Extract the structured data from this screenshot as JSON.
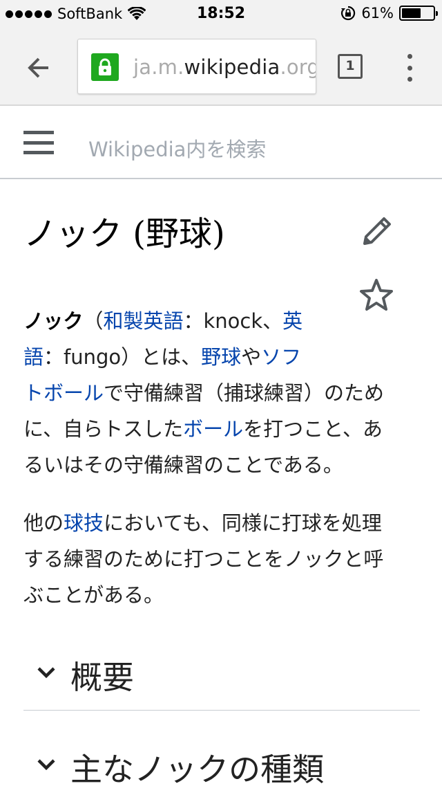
{
  "status_bar": {
    "carrier": "SoftBank",
    "time": "18:52",
    "battery": "61%",
    "battery_level": 0.61
  },
  "browser": {
    "url_domain": "ja.m.wikipedia.org",
    "tab_count": "1"
  },
  "wiki": {
    "search_placeholder": "Wikipedia内を検索",
    "title": "ノック (野球)",
    "para1": {
      "term": "ノック",
      "p_open": "（",
      "link_wasei": "和製英語",
      "t_knock": "：knock、",
      "link_eigo_1": "英",
      "link_eigo_2": "語",
      "t_fungo": "：fungo）とは、",
      "link_yakyu": "野球",
      "t_ya": "や",
      "link_soft_1": "ソフ",
      "link_soft_2": "トボール",
      "t_line3": "で守備練習（捕球練習）のため",
      "t_line4a": "に、自らトスした",
      "link_ball": "ボール",
      "t_line4b": "を打つこと、あ",
      "t_line5": "るいはその守備練習のことである。"
    },
    "para2": {
      "t_line1a": "他の",
      "link_kyugi": "球技",
      "t_line1b": "においても、同様に打球を処理",
      "t_line2": "する練習のために打つことをノックと呼",
      "t_line3": "ぶことがある。"
    },
    "sections": [
      {
        "title": "概要"
      },
      {
        "title": "主なノックの種類"
      }
    ]
  },
  "colors": {
    "link": "#0645ad",
    "lock_badge": "#1fa81f"
  }
}
